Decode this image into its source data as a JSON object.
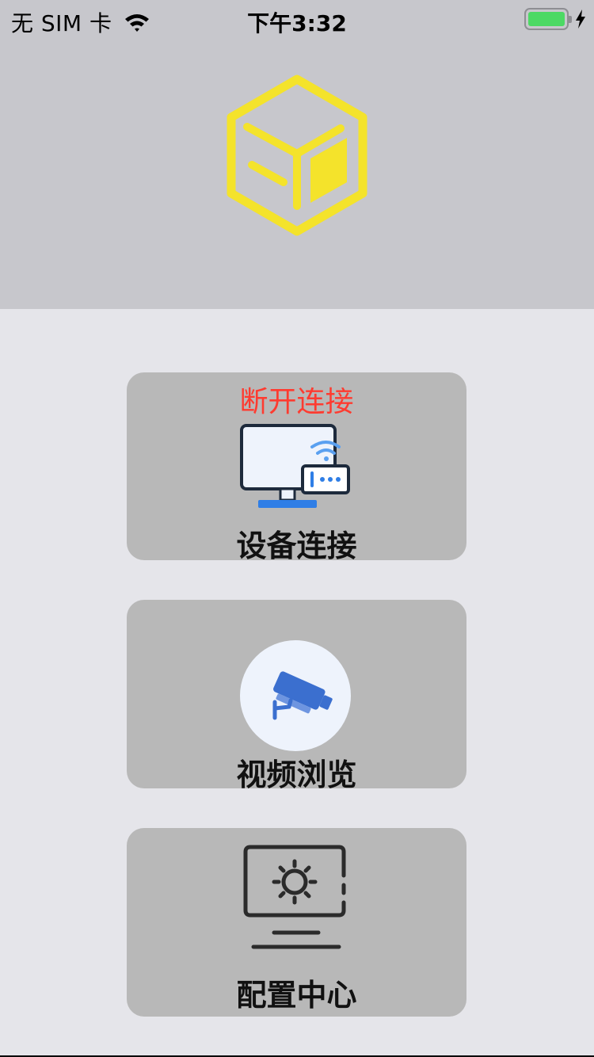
{
  "status_bar": {
    "carrier": "无 SIM 卡",
    "time": "下午3:32",
    "battery_color": "#4cd964"
  },
  "header": {
    "background": "#c7c7cc",
    "logo_icon": "yellow-cube-logo",
    "logo_color": "#f4e32b"
  },
  "menu": {
    "device_connect": {
      "status": "断开连接",
      "label": "设备连接",
      "icon": "monitor-router-icon"
    },
    "video_browse": {
      "label": "视频浏览",
      "icon": "security-camera-icon"
    },
    "config_center": {
      "label": "配置中心",
      "icon": "monitor-settings-icon"
    }
  }
}
